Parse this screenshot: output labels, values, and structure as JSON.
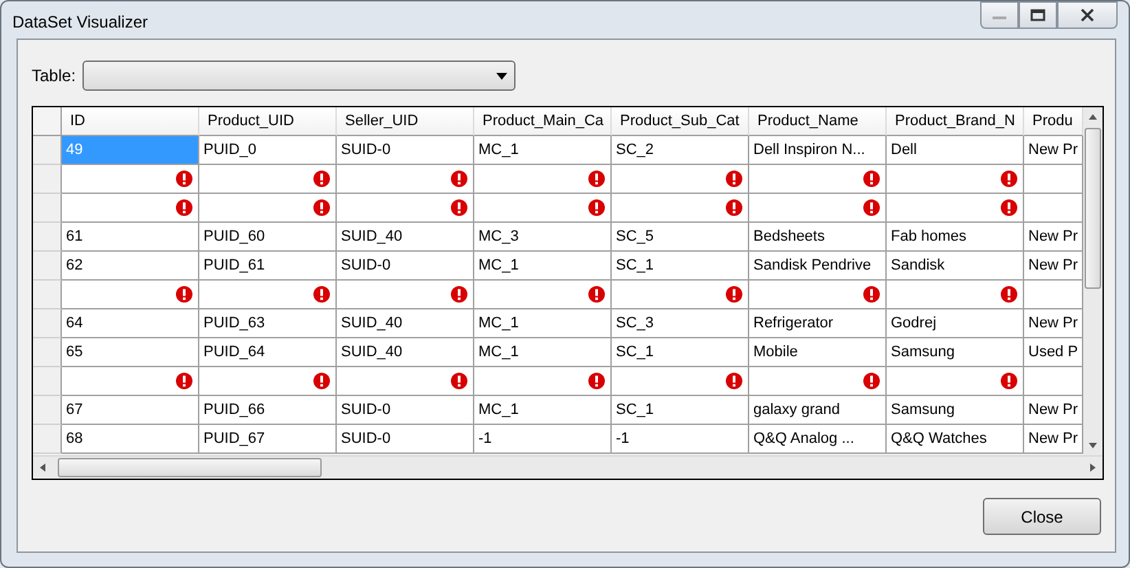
{
  "window": {
    "title": "DataSet Visualizer"
  },
  "table_selector": {
    "label": "Table:"
  },
  "grid": {
    "columns": [
      {
        "label": "ID",
        "cut": false
      },
      {
        "label": "Product_UID",
        "cut": false
      },
      {
        "label": "Seller_UID",
        "cut": false
      },
      {
        "label": "Product_Main_Ca",
        "cut": false
      },
      {
        "label": "Product_Sub_Cat",
        "cut": false
      },
      {
        "label": "Product_Name",
        "cut": false
      },
      {
        "label": "Product_Brand_N",
        "cut": false
      },
      {
        "label": "Produ",
        "cut": true
      }
    ],
    "rows": [
      {
        "kind": "data",
        "selected": true,
        "cells": [
          "49",
          "PUID_0",
          "SUID-0",
          "MC_1",
          "SC_2",
          "Dell Inspiron N...",
          "Dell",
          "New Pr"
        ]
      },
      {
        "kind": "error",
        "selected": false
      },
      {
        "kind": "error",
        "selected": false
      },
      {
        "kind": "data",
        "selected": false,
        "cells": [
          "61",
          "PUID_60",
          "SUID_40",
          "MC_3",
          "SC_5",
          "Bedsheets",
          "Fab homes",
          "New Pr"
        ]
      },
      {
        "kind": "data",
        "selected": false,
        "cells": [
          "62",
          "PUID_61",
          "SUID-0",
          "MC_1",
          "SC_1",
          "Sandisk Pendrive",
          "Sandisk",
          "New Pr"
        ]
      },
      {
        "kind": "error",
        "selected": false
      },
      {
        "kind": "data",
        "selected": false,
        "cells": [
          "64",
          "PUID_63",
          "SUID_40",
          "MC_1",
          "SC_3",
          "Refrigerator",
          "Godrej",
          "New Pr"
        ]
      },
      {
        "kind": "data",
        "selected": false,
        "cells": [
          "65",
          "PUID_64",
          "SUID_40",
          "MC_1",
          "SC_1",
          "Mobile",
          "Samsung",
          "Used P"
        ]
      },
      {
        "kind": "error",
        "selected": false
      },
      {
        "kind": "data",
        "selected": false,
        "cells": [
          "67",
          "PUID_66",
          "SUID-0",
          "MC_1",
          "SC_1",
          "galaxy grand",
          "Samsung",
          "New Pr"
        ]
      },
      {
        "kind": "data",
        "selected": false,
        "cells": [
          "68",
          "PUID_67",
          "SUID-0",
          "-1",
          "-1",
          "Q&Q Analog ...",
          "Q&Q Watches",
          "New Pr"
        ]
      }
    ]
  },
  "buttons": [
    "Close"
  ]
}
